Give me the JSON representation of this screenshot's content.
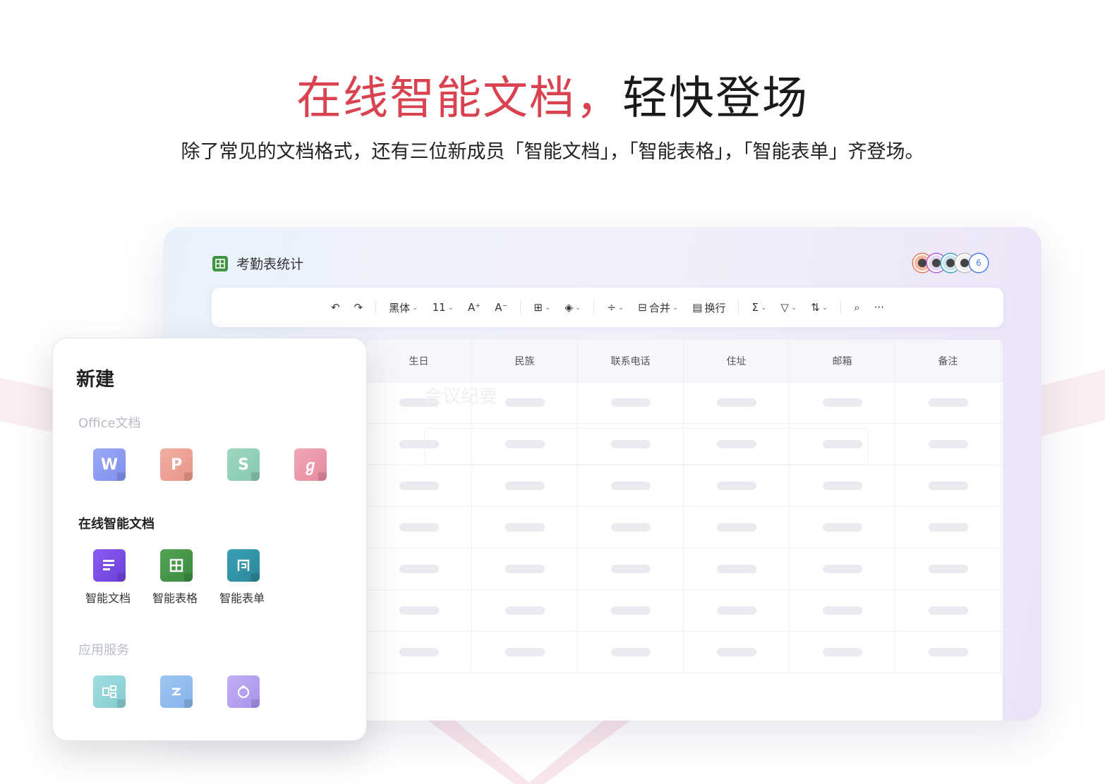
{
  "hero": {
    "title_accent": "在线智能文档，",
    "title_plain": "轻快登场",
    "subtitle": "除了常见的文档格式，还有三位新成员「智能文档」，「智能表格」，「智能表单」齐登场。"
  },
  "window": {
    "title": "考勤表统计",
    "collaborator_count": "6",
    "toolbar": {
      "undo_icon": "↶",
      "redo_icon": "↷",
      "font_family": "黑体",
      "font_size": "11",
      "increase_font_icon": "A⁺",
      "decrease_font_icon": "A⁻",
      "border_icon": "⊞",
      "fill_icon": "◈",
      "strike_icon": "÷",
      "merge_label": "合并",
      "wrap_label": "换行",
      "sum_icon": "Σ",
      "filter_icon": "▽",
      "sort_icon": "⇅",
      "search_icon": "⌕",
      "more_icon": "···"
    },
    "grid": {
      "columns": [
        "生日",
        "民族",
        "联系电话",
        "住址",
        "邮箱",
        "备注"
      ],
      "ghost_text": "会议纪要"
    }
  },
  "new_panel": {
    "title": "新建",
    "office_section": "Office文档",
    "office_icons": [
      {
        "name": "word-icon",
        "glyph": "W"
      },
      {
        "name": "ppt-icon",
        "glyph": "P"
      },
      {
        "name": "spreadsheet-icon",
        "glyph": "S"
      },
      {
        "name": "pdf-icon",
        "glyph": "ℊ"
      }
    ],
    "smart_section": "在线智能文档",
    "smart_items": [
      {
        "label": "智能文档",
        "icon": "smart-doc-icon"
      },
      {
        "label": "智能表格",
        "icon": "smart-sheet-icon"
      },
      {
        "label": "智能表单",
        "icon": "smart-form-icon"
      }
    ],
    "apps_section": "应用服务",
    "app_icons": [
      "org-chart-icon",
      "mindmap-icon",
      "flowchart-icon"
    ]
  }
}
